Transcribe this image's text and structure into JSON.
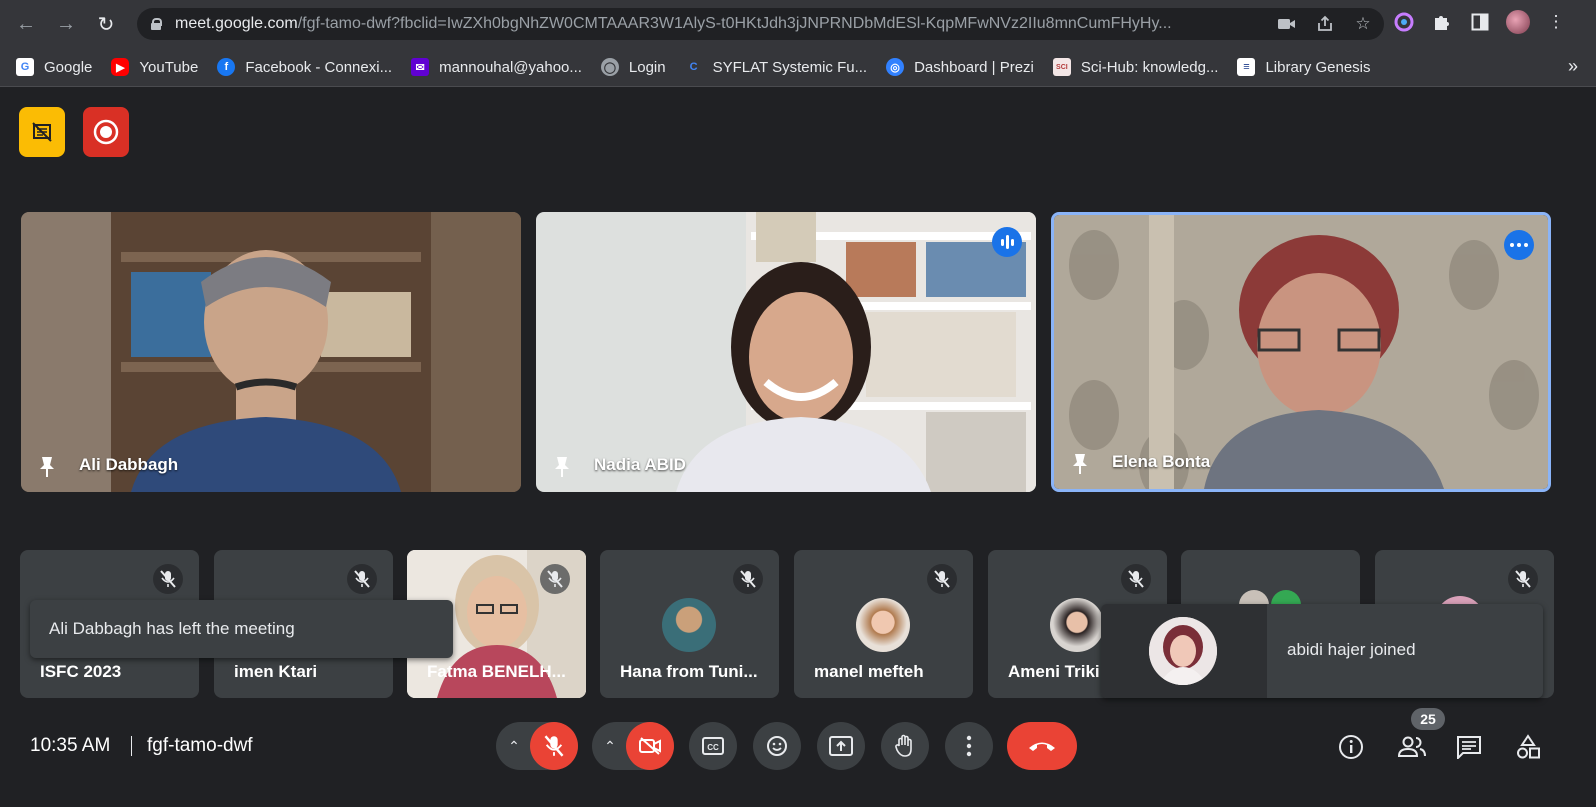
{
  "browser": {
    "url_host": "meet.google.com",
    "url_path": "/fgf-tamo-dwf?fbclid=IwZXh0bgNhZW0CMTAAAR3W1AlyS-t0HKtJdh3jJNPRNDbMdESl-KqpMFwNVz2IIu8mnCumFHyHy...",
    "bookmarks": [
      {
        "label": "Google",
        "icon": "google-icon",
        "color": "#ffffff"
      },
      {
        "label": "YouTube",
        "icon": "youtube-icon",
        "color": "#ff0000"
      },
      {
        "label": "Facebook - Connexi...",
        "icon": "facebook-icon",
        "color": "#1877f2"
      },
      {
        "label": "mannouhal@yahoo...",
        "icon": "yahoo-mail-icon",
        "color": "#6001d2"
      },
      {
        "label": "Login",
        "icon": "globe-icon",
        "color": "#9aa0a6"
      },
      {
        "label": "SYFLAT Systemic Fu...",
        "icon": "syflat-icon",
        "color": "#4285f4"
      },
      {
        "label": "Dashboard | Prezi",
        "icon": "prezi-icon",
        "color": "#3181ff"
      },
      {
        "label": "Sci-Hub: knowledg...",
        "icon": "scihub-icon",
        "color": "#b33b3b"
      },
      {
        "label": "Library Genesis",
        "icon": "libgen-icon",
        "color": "#1a3a8a"
      }
    ]
  },
  "meeting": {
    "time": "10:35 AM",
    "code": "fgf-tamo-dwf",
    "participant_count": "25",
    "toast_left": "Ali Dabbagh has left the meeting",
    "toast_right": "abidi hajer joined"
  },
  "main_tiles": [
    {
      "name": "Ali Dabbagh"
    },
    {
      "name": "Nadia ABID"
    },
    {
      "name": "Elena Bonta"
    }
  ],
  "small_tiles": [
    {
      "name": "ISFC 2023"
    },
    {
      "name": "imen Ktari"
    },
    {
      "name": "Fatma BENELH..."
    },
    {
      "name": "Hana from Tuni..."
    },
    {
      "name": "manel mefteh"
    },
    {
      "name": "Ameni Triki"
    },
    {
      "name": ""
    },
    {
      "name": ""
    }
  ],
  "colors": {
    "accent_blue": "#1a73e8",
    "danger_red": "#ea4335",
    "badge_yellow": "#fbbc04",
    "record_red": "#d93025"
  }
}
